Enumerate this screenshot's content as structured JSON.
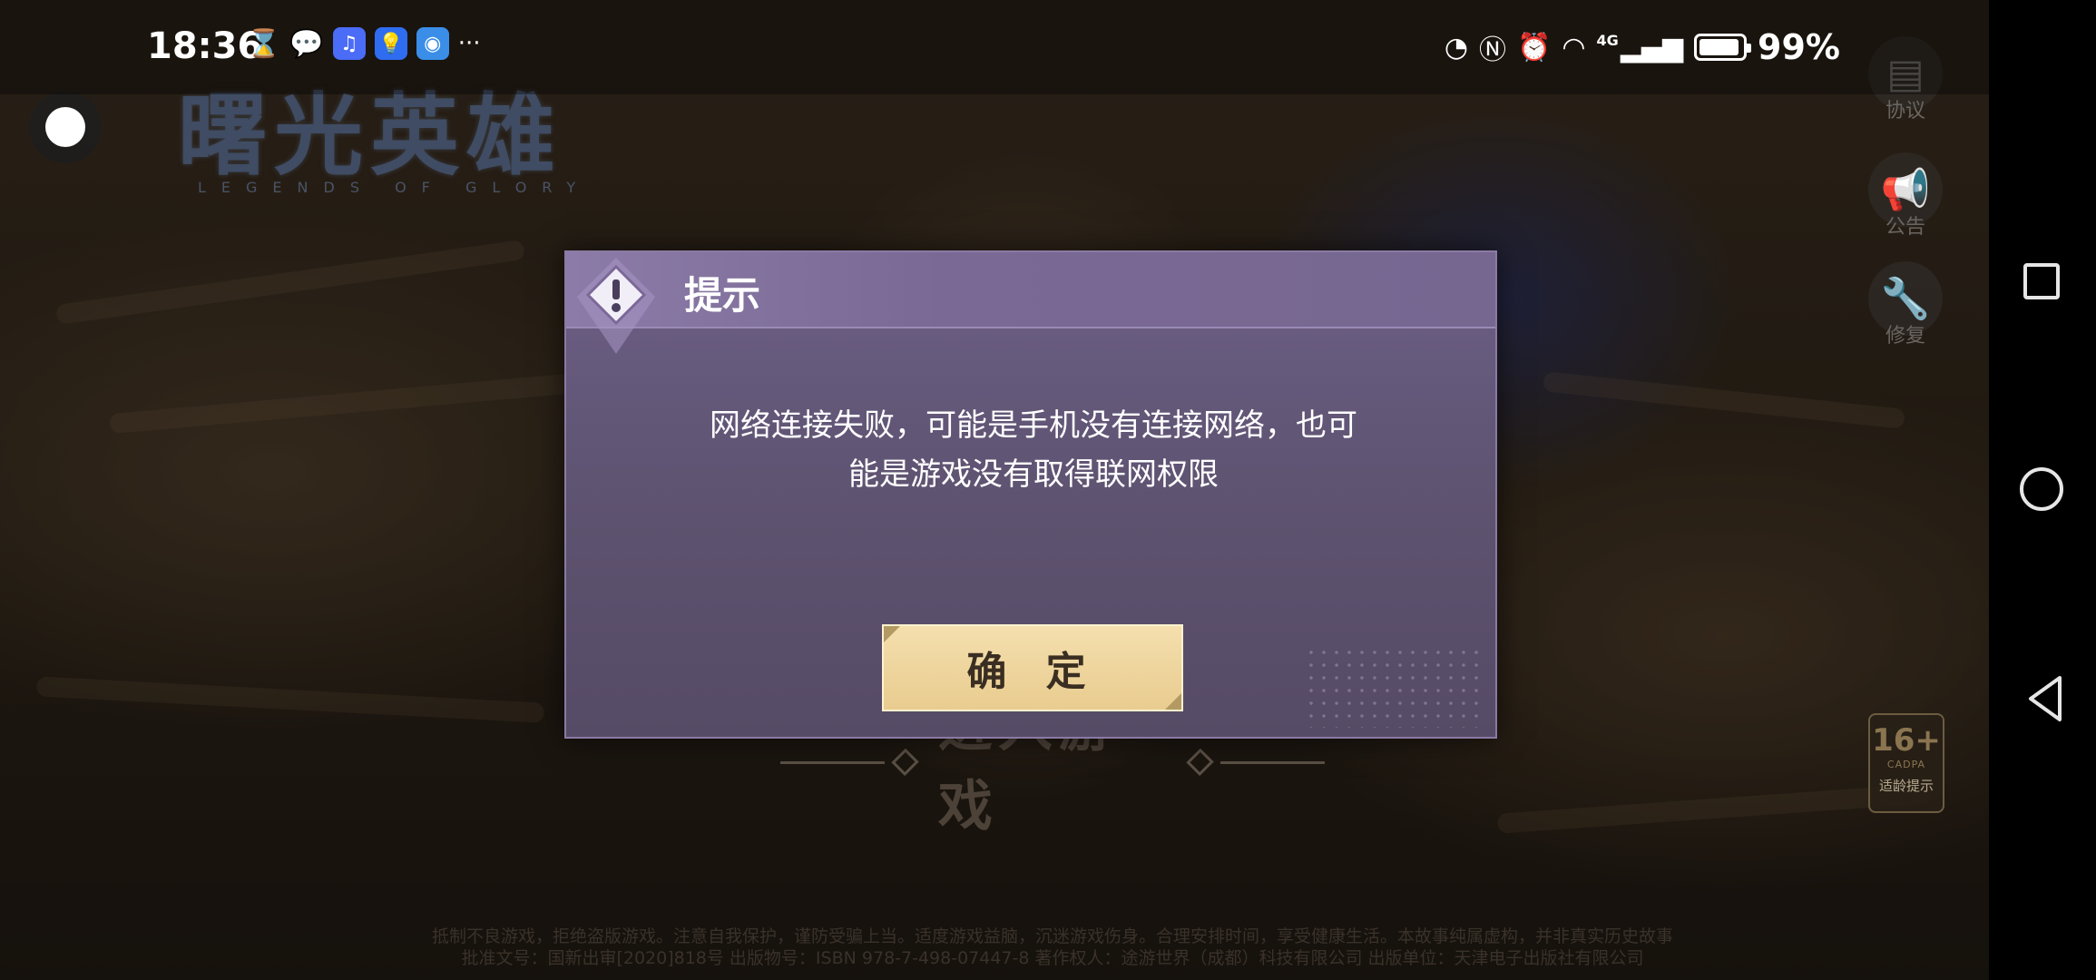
{
  "status_bar": {
    "time": "18:36",
    "battery_percent": "99%",
    "network_type": "4G",
    "left_icons": [
      "hourglass-icon",
      "wechat-icon",
      "music-app-icon",
      "bulb-app-icon",
      "browser-app-icon",
      "more-dots-icon"
    ],
    "right_icons": [
      "data-saver-icon",
      "nfc-icon",
      "alarm-icon",
      "wifi-icon",
      "signal-icon",
      "battery-icon"
    ],
    "overflow_label": "···"
  },
  "game": {
    "logo_title": "曙光英雄",
    "logo_subtitle": "LEGENDS OF GLORY",
    "side_buttons": [
      {
        "icon": "agreement-icon",
        "label": "协议"
      },
      {
        "icon": "megaphone-icon",
        "label": "公告"
      },
      {
        "icon": "wrench-icon",
        "label": "修复"
      }
    ],
    "enter_game": "进入游戏",
    "age_rating": {
      "number": "16+",
      "org": "CADPA",
      "label": "适龄提示"
    },
    "disclaimer_line1": "抵制不良游戏，拒绝盗版游戏。注意自我保护，谨防受骗上当。适度游戏益脑，沉迷游戏伤身。合理安排时间，享受健康生活。本故事纯属虚构，并非真实历史故事",
    "disclaimer_line2": "批准文号：国新出审[2020]818号  出版物号：ISBN 978-7-498-07447-8  著作权人：途游世界（成都）科技有限公司  出版单位：天津电子出版社有限公司"
  },
  "dialog": {
    "title": "提示",
    "message_line1": "网络连接失败，可能是手机没有连接网络，也可",
    "message_line2": "能是游戏没有取得联网权限",
    "confirm_label": "确 定"
  },
  "colors": {
    "dialog_body": "#5d526f",
    "dialog_header": "#8c7ba8",
    "confirm_button": "#ecd39a",
    "nav_bar": "#000000"
  }
}
